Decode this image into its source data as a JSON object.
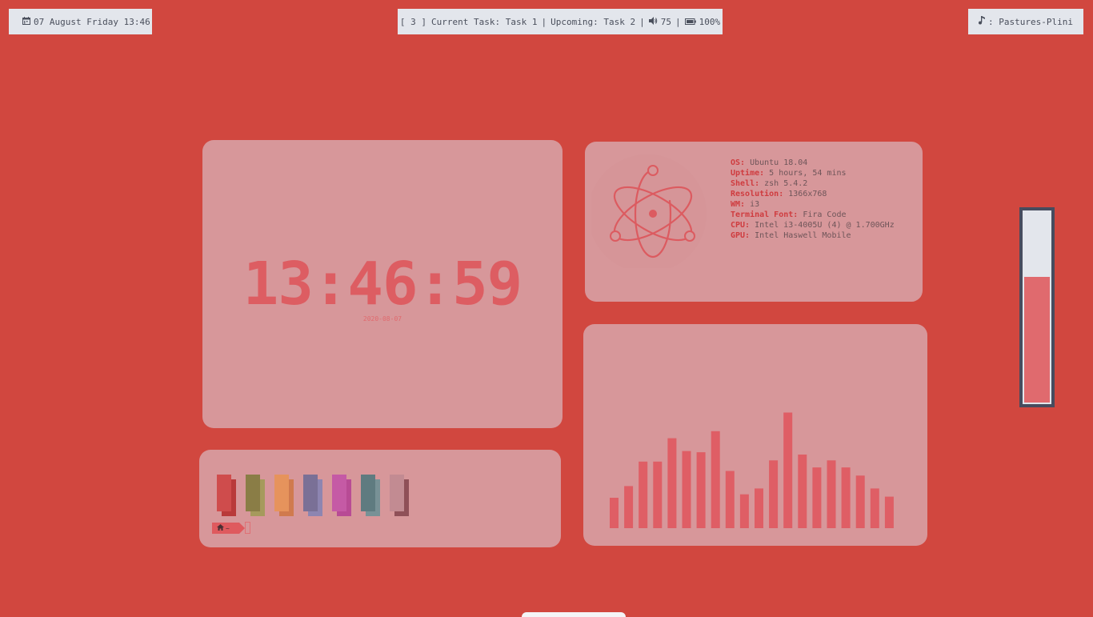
{
  "topbar": {
    "left": {
      "icon": "calendar-icon",
      "text": "07 August Friday 13:46"
    },
    "center": {
      "workspace": "[ 3 ]",
      "task": "Current Task: Task 1",
      "upcoming": "Upcoming: Task 2",
      "volume_icon": "volume-icon",
      "volume": "75",
      "battery_icon": "battery-icon",
      "battery": "100%",
      "separator": "|"
    },
    "right": {
      "icon": "music-icon",
      "text": ": Pastures-Plini"
    }
  },
  "clock": {
    "time": "13:46:59",
    "date": "2020-08-07"
  },
  "sysinfo": {
    "logo_icon": "atom-electron-icon",
    "rows": [
      {
        "key": "OS:",
        "value": " Ubuntu 18.04"
      },
      {
        "key": "Uptime:",
        "value": " 5 hours, 54 mins"
      },
      {
        "key": "Shell:",
        "value": " zsh 5.4.2"
      },
      {
        "key": "Resolution:",
        "value": " 1366x768"
      },
      {
        "key": "WM:",
        "value": " i3"
      },
      {
        "key": "Terminal Font:",
        "value": " Fira Code"
      },
      {
        "key": "CPU:",
        "value": " Intel i3-4005U (4) @ 1.700GHz"
      },
      {
        "key": "GPU:",
        "value": " Intel Haswell Mobile"
      }
    ]
  },
  "visualizer": {
    "bar_color": "#df5e65",
    "levels": [
      0.26,
      0.36,
      0.57,
      0.57,
      0.77,
      0.66,
      0.65,
      0.83,
      0.49,
      0.29,
      0.34,
      0.58,
      0.99,
      0.63,
      0.52,
      0.58,
      0.52,
      0.45,
      0.34,
      0.27
    ]
  },
  "terminal": {
    "swatch_colors": [
      [
        "#cf4c4c",
        "#b93a3a"
      ],
      [
        "#8a7d46",
        "#a69a5c"
      ],
      [
        "#e6935c",
        "#d07a4e"
      ],
      [
        "#7a7096",
        "#8d85b1"
      ],
      [
        "#c55aa5",
        "#b84b95"
      ],
      [
        "#5f7b80",
        "#789196"
      ],
      [
        "#c28b92",
        "#8f5058"
      ]
    ],
    "prompt_icon": "home-icon",
    "prompt_text": "~"
  },
  "volume_meter": {
    "level": 0.66,
    "fill_color": "#e06a6e"
  }
}
